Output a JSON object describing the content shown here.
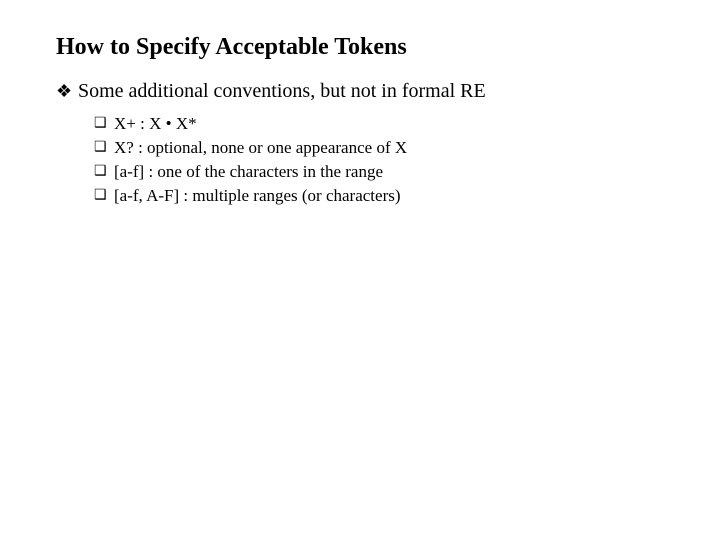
{
  "slide": {
    "title": "How to Specify Acceptable Tokens",
    "bullet_l1": "Some additional conventions, but not in formal RE",
    "items": {
      "i0": "X+ : X • X*",
      "i1": "X? : optional, none or one appearance of X",
      "i2": "[a-f] : one of the characters in the range",
      "i3": "[a-f, A-F] : multiple ranges (or characters)"
    }
  },
  "glyphs": {
    "diamond": "❖",
    "square": "❑"
  }
}
